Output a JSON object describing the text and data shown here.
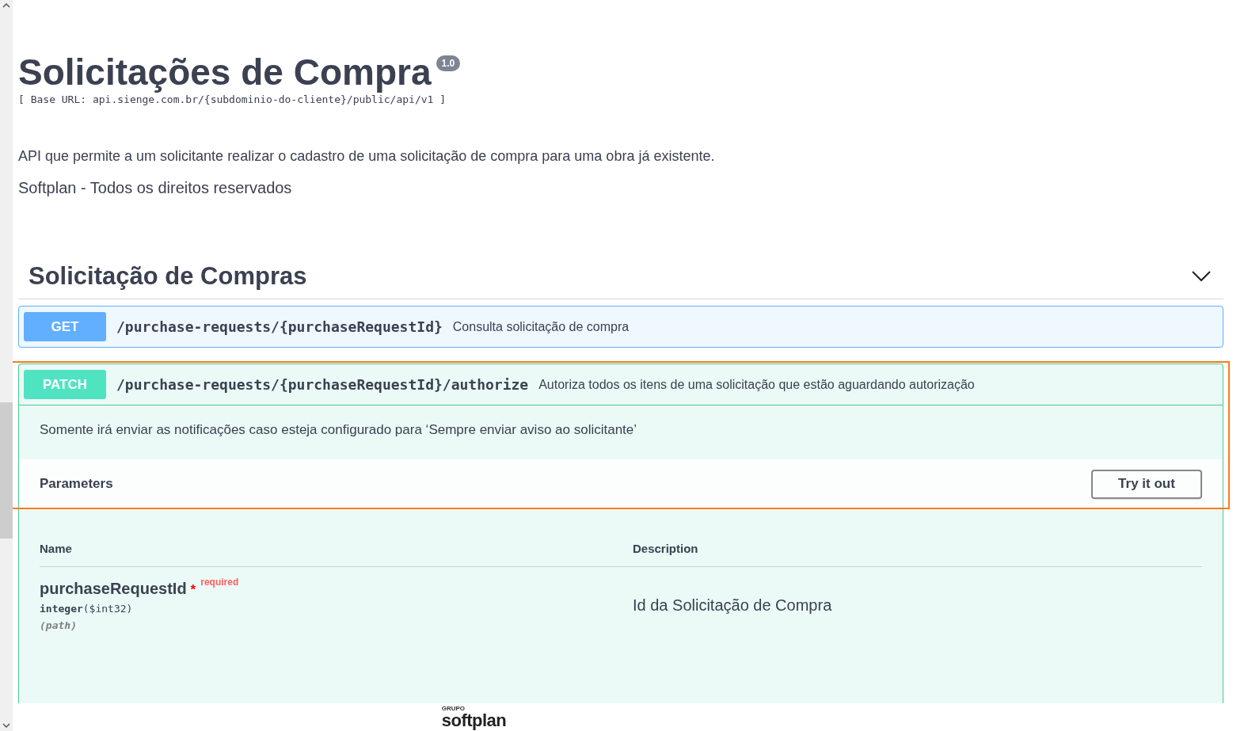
{
  "info": {
    "title": "Solicitações de Compra",
    "version": "1.0",
    "base_url": "[ Base URL: api.sienge.com.br/{subdominio-do-cliente}/public/api/v1 ]",
    "description": "API que permite a um solicitante realizar o cadastro de uma solicitação de compra para uma obra já existente.",
    "copyright": "Softplan - Todos os direitos reservados"
  },
  "section": {
    "title": "Solicitação de Compras",
    "expanded": true
  },
  "operations": [
    {
      "method": "GET",
      "path": "/purchase-requests/{purchaseRequestId}",
      "summary": "Consulta solicitação de compra",
      "expanded": false,
      "highlighted": false
    },
    {
      "method": "PATCH",
      "path": "/purchase-requests/{purchaseRequestId}/authorize",
      "summary": "Autoriza todos os itens de uma solicitação que estão aguardando autorização",
      "expanded": true,
      "highlighted": true,
      "description": "Somente irá enviar as notificações caso esteja configurado para ‘Sempre enviar aviso ao solicitante’",
      "parameters_title": "Parameters",
      "try_button": "Try it out",
      "columns": [
        "Name",
        "Description"
      ],
      "parameters": [
        {
          "name": "purchaseRequestId",
          "required_mark": "*",
          "required_label": "required",
          "type": "integer",
          "format": "($int32)",
          "location": "(path)",
          "description": "Id da Solicitação de Compra"
        }
      ]
    }
  ],
  "footer": {
    "logo_small": "GRUPO",
    "logo": "softplan"
  }
}
